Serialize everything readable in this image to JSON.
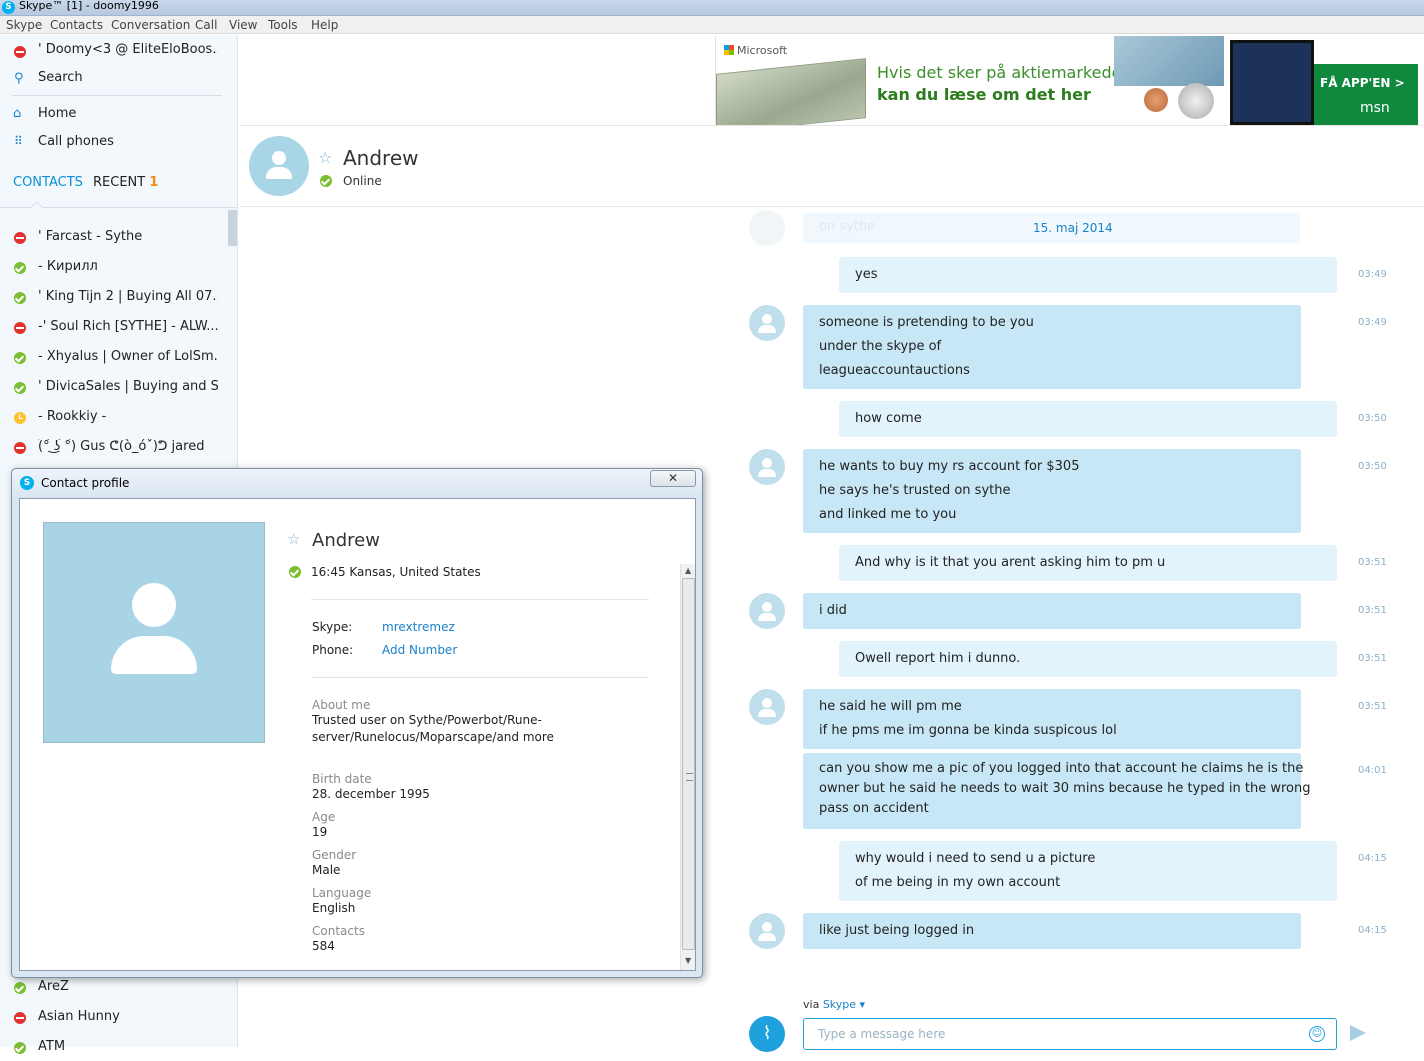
{
  "window": {
    "title": "Skype™ [1] - doomy1996"
  },
  "menu": [
    "Skype",
    "Contacts",
    "Conversation",
    "Call",
    "View",
    "Tools",
    "Help"
  ],
  "sidebar": {
    "profile": "'   Doomy<3  @  EliteEloBoos...",
    "search": "Search",
    "home": "Home",
    "call_phones": "Call phones",
    "tab_contacts": "CONTACTS",
    "tab_recent": "RECENT",
    "recent_count": "1",
    "contacts": [
      {
        "name": "'       Farcast - Sythe",
        "status": "busy"
      },
      {
        "name": "-       Кирилл",
        "status": "online"
      },
      {
        "name": "'    King Tijn 2 | Buying All 07...",
        "status": "online"
      },
      {
        "name": "-'     Soul Rich [SYTHE] - ALW...",
        "status": "busy"
      },
      {
        "name": "-   Xhyalus | Owner of LolSm...",
        "status": "online"
      },
      {
        "name": "' DivicaSales | Buying and Se...",
        "status": "online"
      },
      {
        "name": "- Rookkiy -",
        "status": "away"
      },
      {
        "name": "(͡° ͜ʖ ͡°) Gus ᕦ(ò_óˇ)ᕤ jared",
        "status": "busy"
      }
    ],
    "contacts_bottom": [
      {
        "name": "AreZ",
        "status": "online"
      },
      {
        "name": "Asian Hunny",
        "status": "busy"
      },
      {
        "name": "ATM",
        "status": "online"
      }
    ]
  },
  "ad": {
    "brand": "Microsoft",
    "line1": "Hvis det sker på aktiemarkedet,",
    "line2": "kan du læse om det her",
    "cta": "FÅ APP'EN >",
    "cta_brand": "msn"
  },
  "conversation": {
    "name": "Andrew",
    "status": "Online",
    "date": "15. maj 2014",
    "ghost_text": "on sythe",
    "messages": [
      {
        "from": "me",
        "lines": [
          "yes"
        ],
        "time": "03:49"
      },
      {
        "from": "them",
        "lines": [
          "someone is pretending to be you",
          "under the skype of",
          "leagueaccountauctions"
        ],
        "time": "03:49"
      },
      {
        "from": "me",
        "lines": [
          "how come"
        ],
        "time": "03:50"
      },
      {
        "from": "them",
        "lines": [
          "he wants to buy my rs account for $305",
          "he says he's trusted on sythe",
          "and linked me to you"
        ],
        "time": "03:50"
      },
      {
        "from": "me",
        "lines": [
          "And why is it that you arent asking him to pm u"
        ],
        "time": "03:51"
      },
      {
        "from": "them",
        "lines": [
          "i did"
        ],
        "time": "03:51"
      },
      {
        "from": "me",
        "lines": [
          "Owell report him i dunno."
        ],
        "time": "03:51"
      },
      {
        "from": "them",
        "lines": [
          "he said he will pm me",
          "if he pms me im gonna be kinda suspicous lol"
        ],
        "time": "03:51"
      },
      {
        "from": "them",
        "lines": [
          "can you show me a pic of you logged into that account he claims he is the",
          "owner but he said he needs to wait 30 mins because he typed in the wrong",
          "pass on accident"
        ],
        "time": "04:01"
      },
      {
        "from": "me",
        "lines": [
          "why would i need to send u a picture",
          "of me being in my own account"
        ],
        "time": "04:15"
      },
      {
        "from": "them",
        "lines": [
          "like just being logged in"
        ],
        "time": "04:15"
      }
    ],
    "via_label": "via",
    "via_service": "Skype",
    "input_placeholder": "Type a message here"
  },
  "profile_dialog": {
    "title": "Contact profile",
    "close": "✕",
    "name": "Andrew",
    "location": "16:45 Kansas, United States",
    "skype_label": "Skype:",
    "skype_value": "mrextremez",
    "phone_label": "Phone:",
    "phone_value": "Add Number",
    "about_label": "About me",
    "about_value": "Trusted user on Sythe/Powerbot/Rune-server/Runelocus/Moparscape/and more",
    "birth_label": "Birth date",
    "birth_value": "28. december 1995",
    "age_label": "Age",
    "age_value": "19",
    "gender_label": "Gender",
    "gender_value": "Male",
    "language_label": "Language",
    "language_value": "English",
    "contacts_label": "Contacts",
    "contacts_value": "584"
  }
}
